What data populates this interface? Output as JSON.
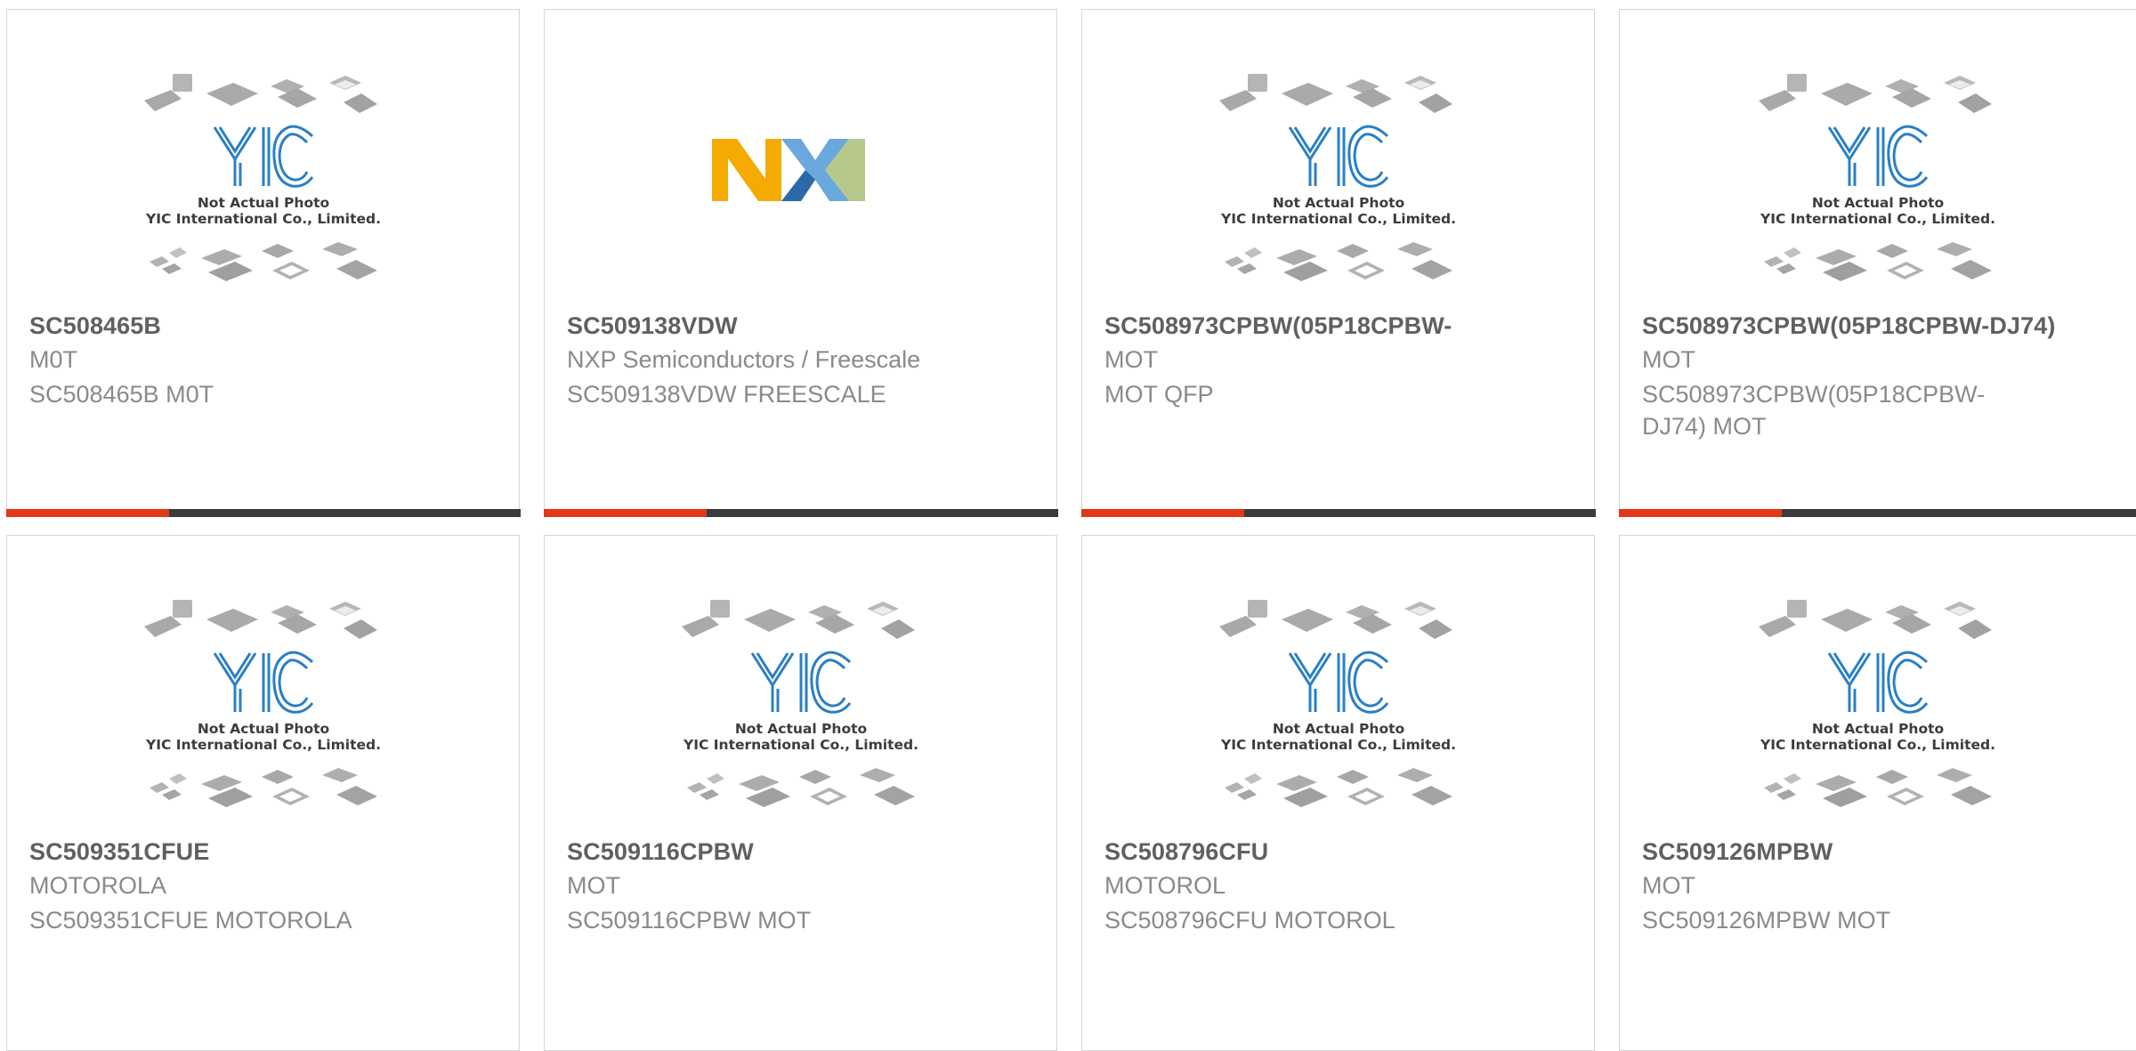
{
  "placeholder": {
    "line1": "Not Actual Photo",
    "line2": "YIC International Co., Limited."
  },
  "colors": {
    "accent": "#e3371a",
    "bar": "#3b3b3b",
    "yic_blue": "#2a7fc4"
  },
  "products": [
    {
      "part": "SC508465B",
      "maker": "M0T",
      "desc": "SC508465B M0T",
      "image": "yic-placeholder"
    },
    {
      "part": "SC509138VDW",
      "maker": "NXP Semiconductors / Freescale",
      "desc": "SC509138VDW FREESCALE",
      "image": "nxp-logo"
    },
    {
      "part": "SC508973CPBW(05P18CPBW-",
      "maker": "MOT",
      "desc": "MOT QFP",
      "image": "yic-placeholder"
    },
    {
      "part": "SC508973CPBW(05P18CPBW-DJ74)",
      "maker": "MOT",
      "desc": "SC508973CPBW(05P18CPBW-DJ74) MOT",
      "image": "yic-placeholder"
    },
    {
      "part": "SC509351CFUE",
      "maker": "MOTOROLA",
      "desc": "SC509351CFUE MOTOROLA",
      "image": "yic-placeholder"
    },
    {
      "part": "SC509116CPBW",
      "maker": "MOT",
      "desc": "SC509116CPBW MOT",
      "image": "yic-placeholder"
    },
    {
      "part": "SC508796CFU",
      "maker": "MOTOROL",
      "desc": "SC508796CFU MOTOROL",
      "image": "yic-placeholder"
    },
    {
      "part": "SC509126MPBW",
      "maker": "MOT",
      "desc": "SC509126MPBW MOT",
      "image": "yic-placeholder"
    }
  ]
}
